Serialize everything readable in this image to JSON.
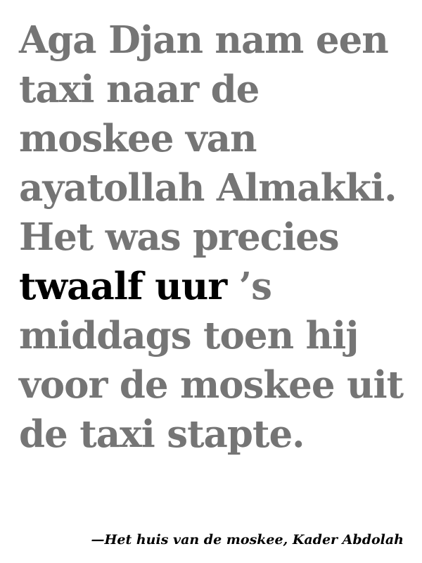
{
  "quote": {
    "lines": [
      "Aga Djan nam een",
      "taxi naar de",
      "moskee van",
      "ayatollah Almakki.",
      "Het was precies",
      "",
      "middags toen hij",
      "voor de moskee uit",
      "de taxi stapte."
    ],
    "highlight": "twaalf uur",
    "after_highlight": " ’s"
  },
  "attribution": "—Het huis van de moskee, Kader Abdolah",
  "colors": {
    "body_text": "#757575",
    "highlight_text": "#000000",
    "background": "#ffffff"
  }
}
